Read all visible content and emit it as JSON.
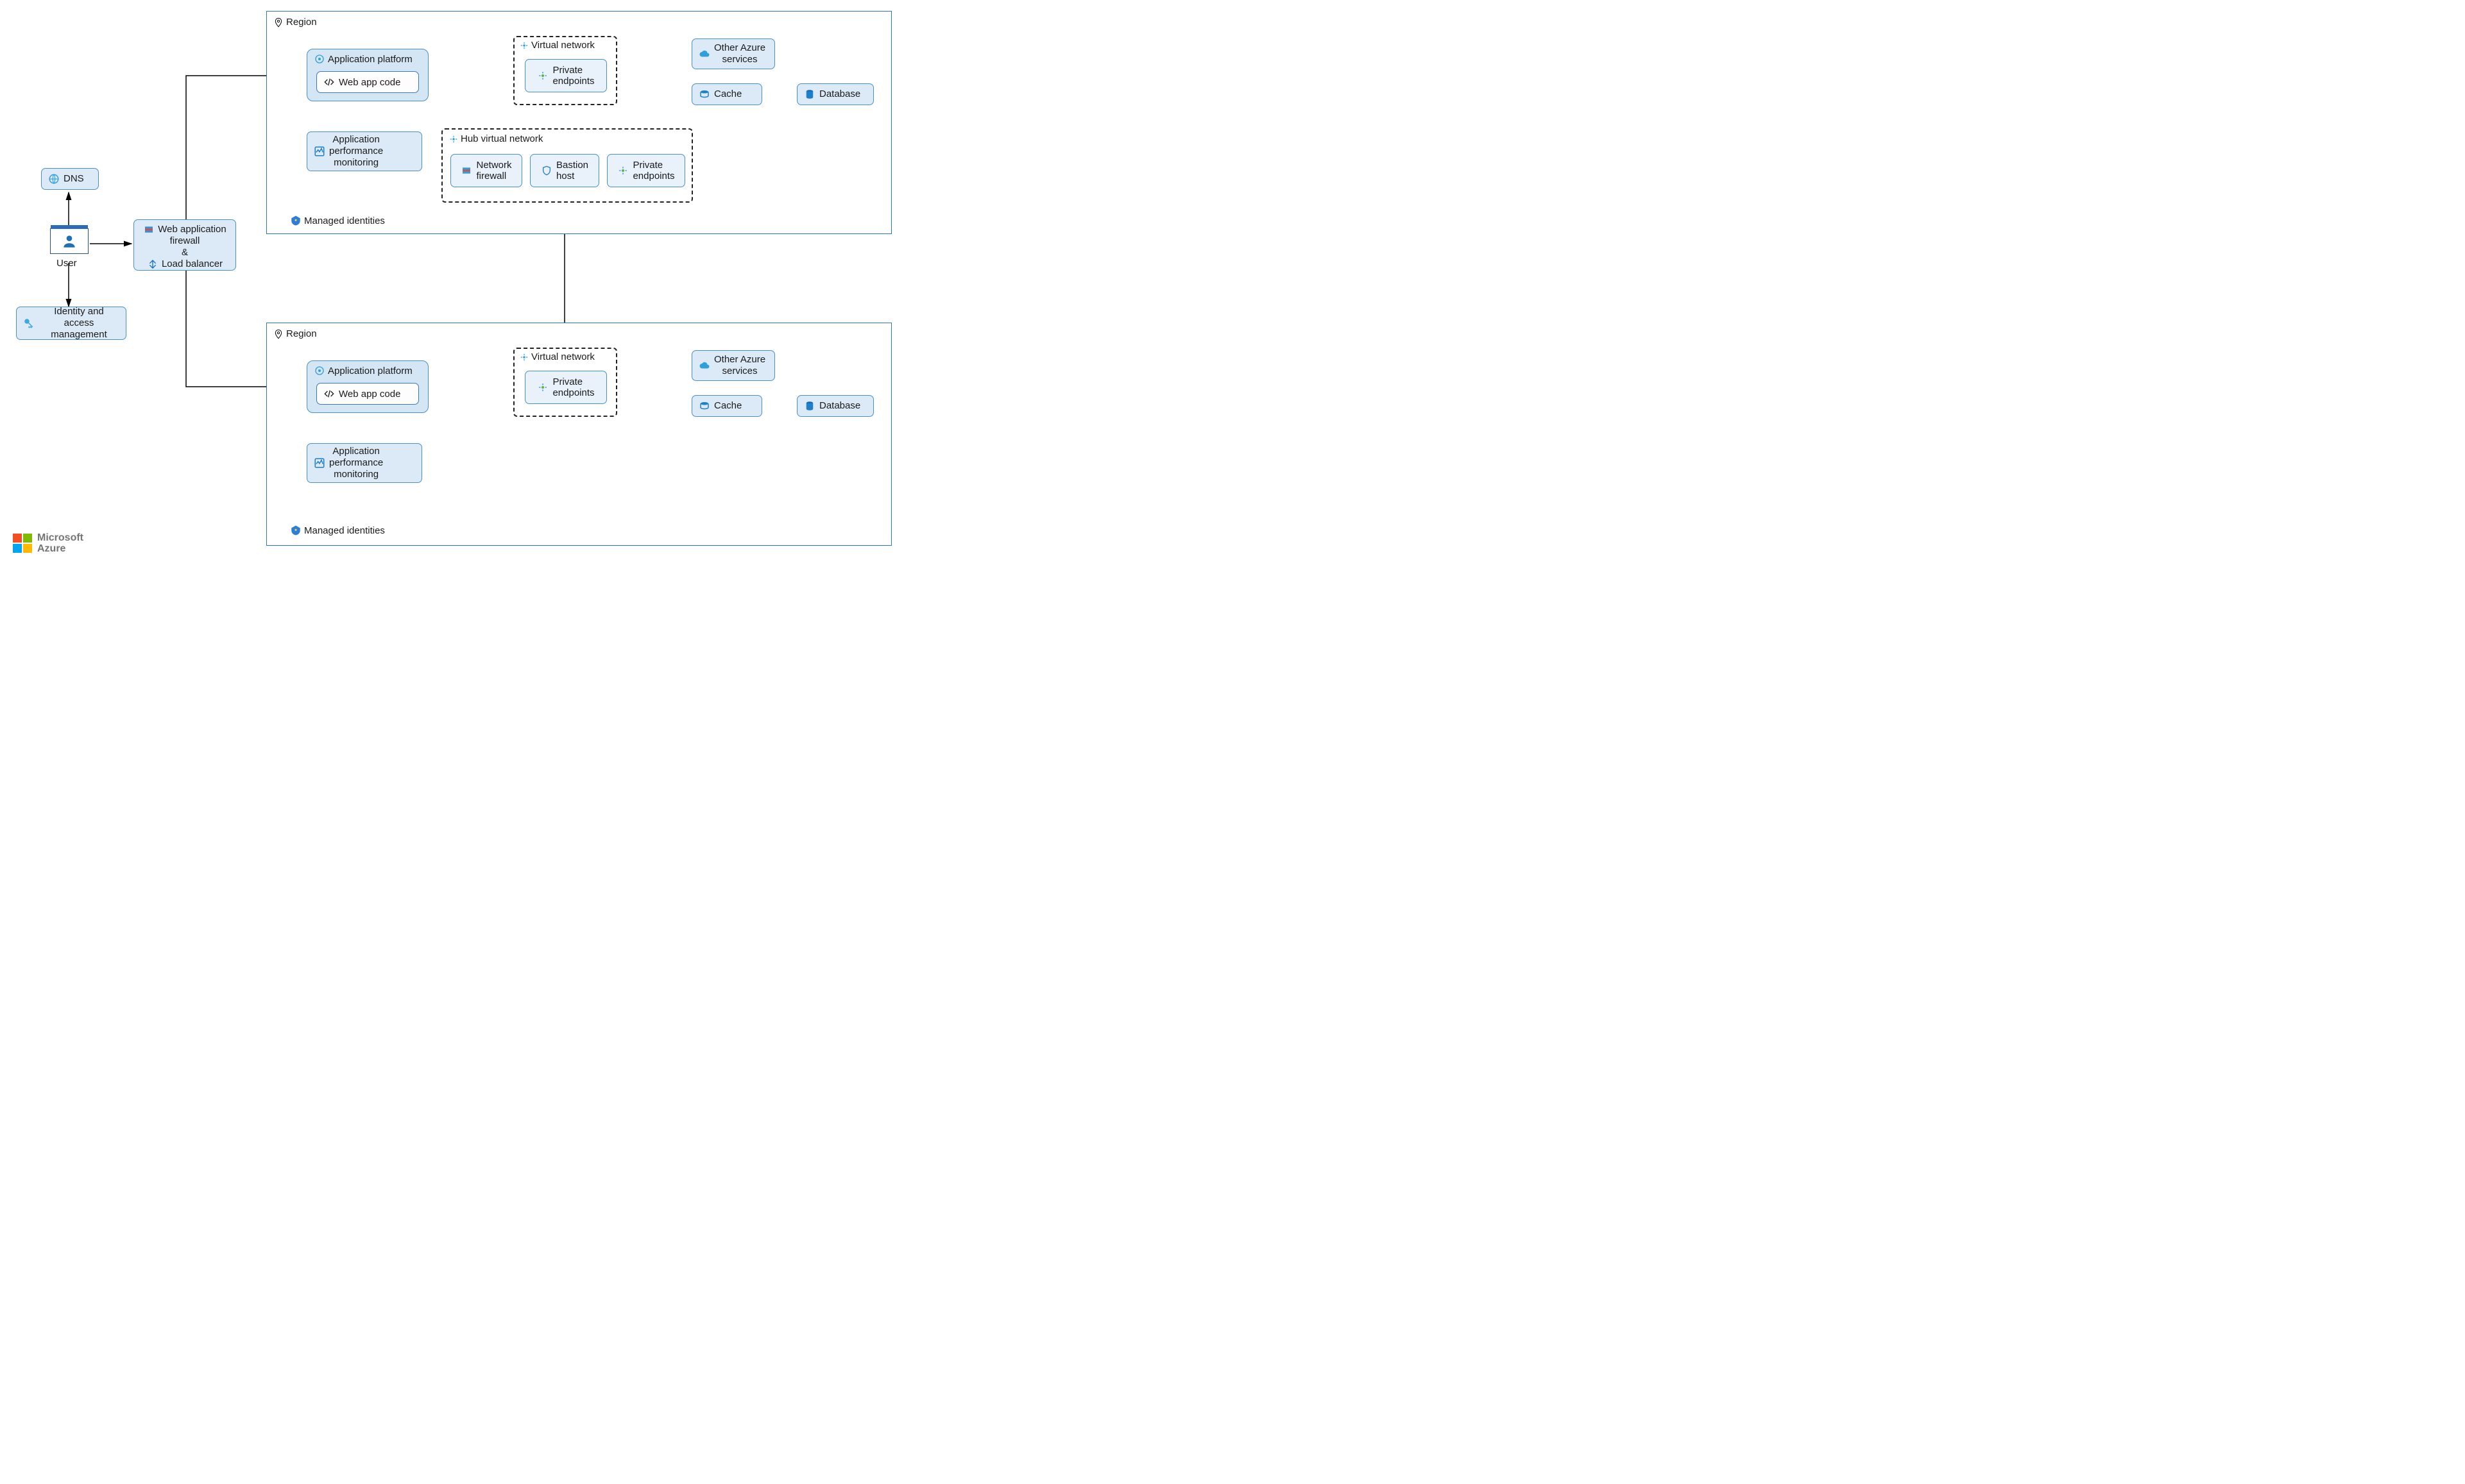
{
  "user_label": "User",
  "dns": "DNS",
  "iam": "Identity and access\nmanagement",
  "waf_line1": "Web application",
  "waf_line2": "firewall",
  "waf_ampersand": "&",
  "waf_line3": "Load balancer",
  "region_label": "Region",
  "app_platform": "Application platform",
  "web_app_code": "Web app code",
  "apm": "Application\nperformance\nmonitoring",
  "vnet": "Virtual network",
  "private_endpoints": "Private\nendpoints",
  "hub_vnet": "Hub virtual network",
  "network_firewall": "Network\nfirewall",
  "bastion_host": "Bastion\nhost",
  "other_azure": "Other Azure\nservices",
  "cache": "Cache",
  "database": "Database",
  "managed_identities": "Managed identities",
  "logo_brand1": "Microsoft",
  "logo_brand2": "Azure"
}
